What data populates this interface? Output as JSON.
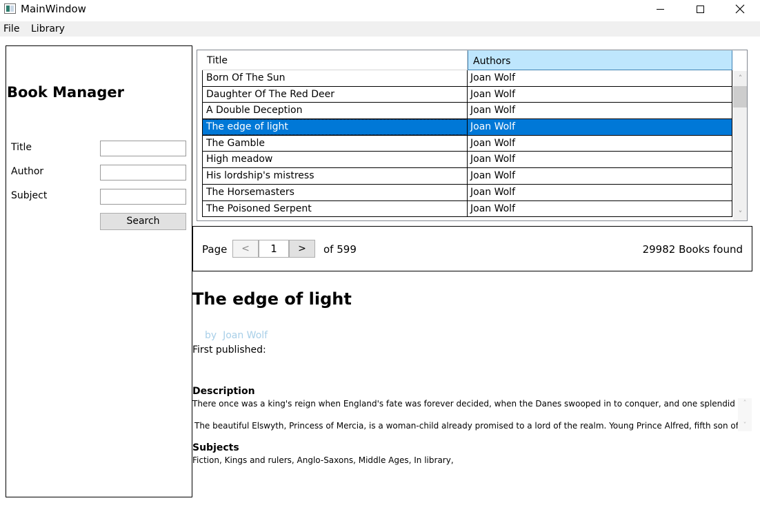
{
  "window": {
    "title": "MainWindow"
  },
  "menu": {
    "items": [
      "File",
      "Library"
    ]
  },
  "sidebar": {
    "heading": "Book Manager",
    "title_label": "Title",
    "author_label": "Author",
    "subject_label": "Subject",
    "title_value": "",
    "author_value": "",
    "subject_value": "",
    "search_label": "Search"
  },
  "grid": {
    "columns": [
      "Title",
      "Authors"
    ],
    "rows": [
      {
        "title": "Born Of The Sun",
        "author": "Joan Wolf"
      },
      {
        "title": "Daughter Of The Red Deer",
        "author": "Joan Wolf"
      },
      {
        "title": "A Double Deception",
        "author": "Joan Wolf"
      },
      {
        "title": "The edge of light",
        "author": "Joan Wolf",
        "selected": true
      },
      {
        "title": "The Gamble",
        "author": "Joan Wolf"
      },
      {
        "title": "High meadow",
        "author": "Joan Wolf"
      },
      {
        "title": "His lordship's mistress",
        "author": "Joan Wolf"
      },
      {
        "title": "The Horsemasters",
        "author": "Joan Wolf"
      },
      {
        "title": "The Poisoned Serpent",
        "author": "Joan Wolf"
      }
    ]
  },
  "pager": {
    "page_label": "Page",
    "prev_label": "<",
    "next_label": ">",
    "current_page": "1",
    "of_label": "of 599",
    "books_found": "29982 Books found"
  },
  "details": {
    "title": "The edge of light",
    "by_label": "by",
    "author": "Joan Wolf",
    "first_published_label": "First published:",
    "description_heading": "Description",
    "description_lines": [
      "There once was a king's reign when England's fate was forever decided, when the Danes swooped in to conquer, and one splendid ruler stood b",
      "The beautiful Elswyth, Princess of Mercia, is a woman-child already promised to a lord of the realm. Young Prince Alfred, fifth son of King Ethelw"
    ],
    "subjects_heading": "Subjects",
    "subjects": "Fiction, Kings and rulers, Anglo-Saxons, Middle Ages, In library,"
  },
  "colors": {
    "selection": "#0078d7",
    "header_highlight": "#bee6fd",
    "author_link": "#a8cfe8",
    "menubar": "#f0f0f0"
  }
}
